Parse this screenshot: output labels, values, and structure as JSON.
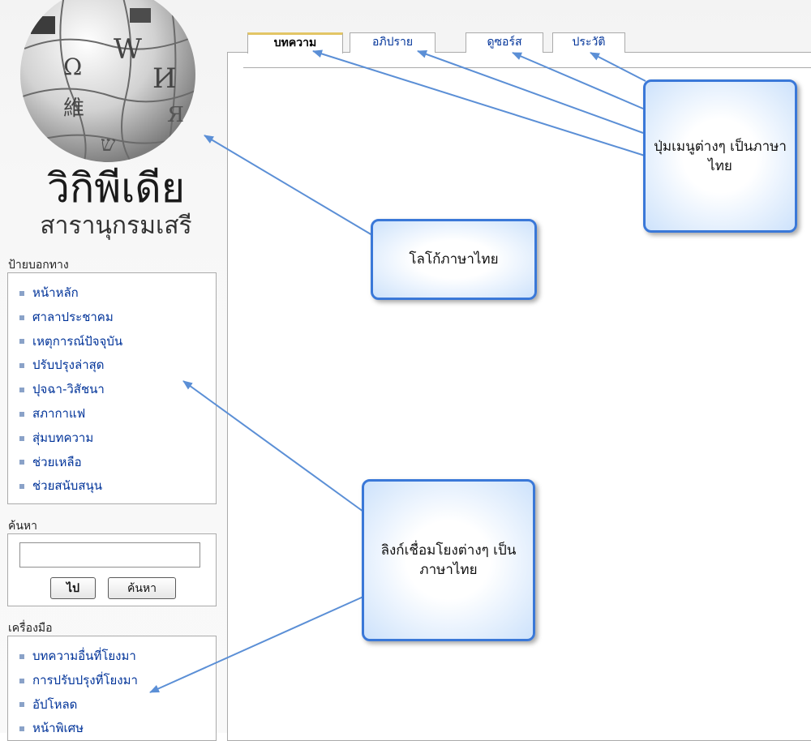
{
  "logo": {
    "title": "วิกิพีเดีย",
    "subtitle": "สารานุกรมเสรี",
    "puzzle_glyphs": [
      "W",
      "Ω",
      "И",
      "Я",
      "維",
      "ש"
    ]
  },
  "tabs": [
    {
      "label": "บทความ",
      "selected": true
    },
    {
      "label": "อภิปราย",
      "selected": false
    },
    {
      "label": "ดูซอร์ส",
      "selected": false
    },
    {
      "label": "ประวัติ",
      "selected": false
    }
  ],
  "navigation": {
    "title": "ป้ายบอกทาง",
    "items": [
      "หน้าหลัก",
      "ศาลาประชาคม",
      "เหตุการณ์ปัจจุบัน",
      "ปรับปรุงล่าสุด",
      "ปุจฉา-วิสัชนา",
      "สภากาแฟ",
      "สุ่มบทความ",
      "ช่วยเหลือ",
      "ช่วยสนับสนุน"
    ]
  },
  "search": {
    "title": "ค้นหา",
    "value": "",
    "go_label": "ไป",
    "search_label": "ค้นหา"
  },
  "toolbox": {
    "title": "เครื่องมือ",
    "items": [
      "บทความอื่นที่โยงมา",
      "การปรับปรุงที่โยงมา",
      "อัปโหลด",
      "หน้าพิเศษ"
    ]
  },
  "callouts": {
    "menu": "ปุ่มเมนูต่างๆ เป็นภาษาไทย",
    "logo": "โลโก้ภาษาไทย",
    "links": "ลิงก์เชื่อมโยงต่างๆ เป็นภาษาไทย"
  },
  "colors": {
    "link": "#003399",
    "callout_border": "#3a78d8",
    "arrow": "#5b8fd6",
    "selected_tab_accent": "#e2c565"
  }
}
